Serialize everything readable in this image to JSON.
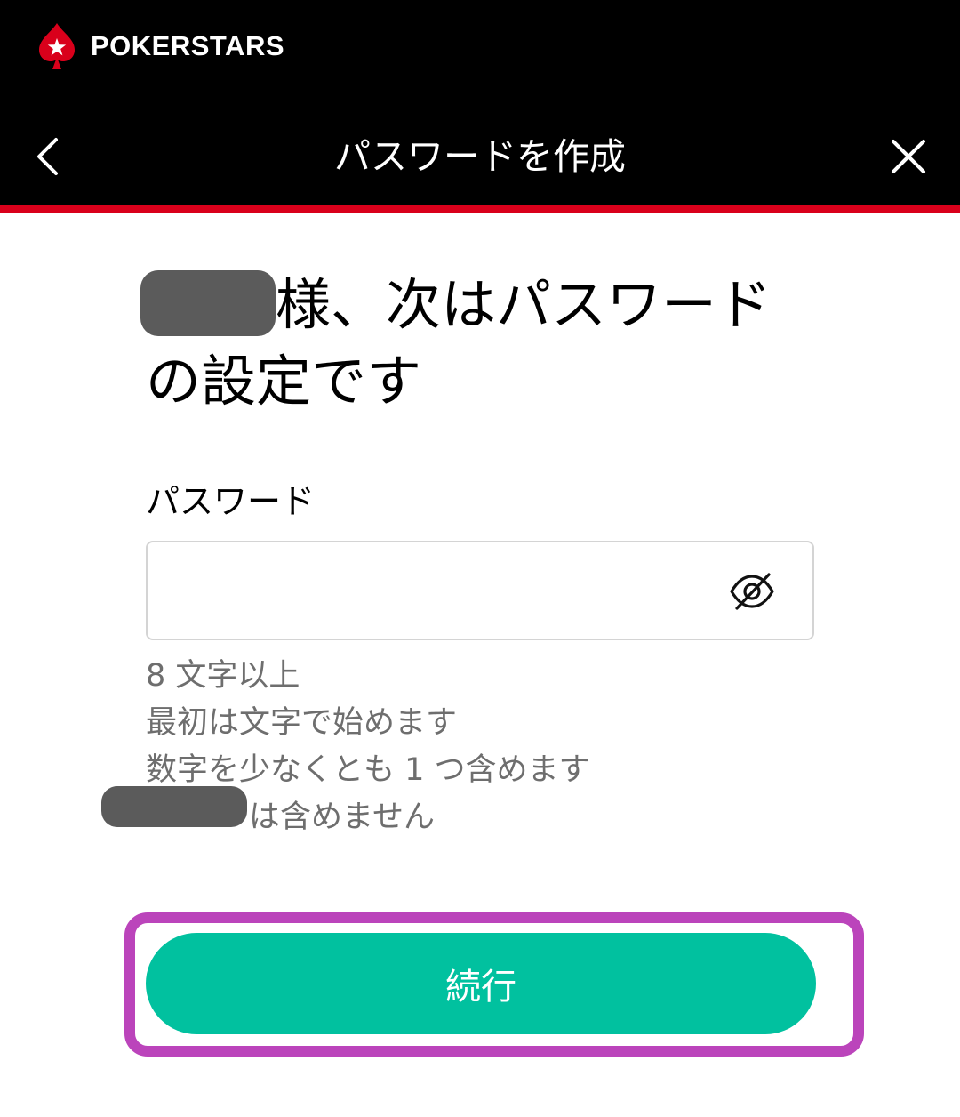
{
  "brand": {
    "name": "POKERSTARS",
    "logo_icon": "spade-star-icon",
    "accent_color": "#d9001b"
  },
  "header": {
    "title": "パスワードを作成",
    "back_icon": "chevron-left-icon",
    "close_icon": "close-icon"
  },
  "main": {
    "heading_after_name": "様、次はパスワードの設定です",
    "password_field": {
      "label": "パスワード",
      "value": "",
      "placeholder": "",
      "toggle_icon": "eye-off-icon"
    },
    "rules": [
      "8 文字以上",
      "最初は文字で始めます",
      "数字を少なくとも 1 つ含めます",
      "は含めません"
    ],
    "continue_button": {
      "label": "続行",
      "color": "#01c19f"
    },
    "highlight_color": "#bb44bb"
  }
}
